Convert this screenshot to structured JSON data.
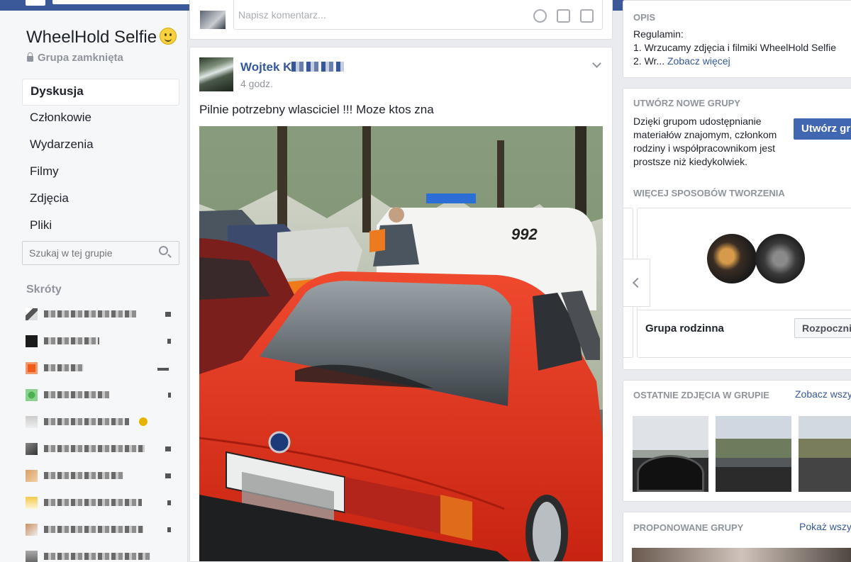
{
  "topbar": {
    "search_placeholder": ""
  },
  "group": {
    "title": "WheelHold Selfie",
    "privacy": "Grupa zamknięta"
  },
  "nav": [
    {
      "label": "Dyskusja",
      "active": true
    },
    {
      "label": "Członkowie"
    },
    {
      "label": "Wydarzenia"
    },
    {
      "label": "Filmy"
    },
    {
      "label": "Zdjęcia"
    },
    {
      "label": "Pliki"
    }
  ],
  "group_search": {
    "placeholder": "Szukaj w tej grupie"
  },
  "shortcuts": {
    "heading": "Skróty",
    "icons": [
      "group-icon",
      "page-icon",
      "app-icon",
      "game-icon",
      "group-icon",
      "group-icon",
      "group-icon",
      "group-icon",
      "group-icon",
      "group-icon"
    ]
  },
  "composer": {
    "placeholder": "Napisz komentarz..."
  },
  "post": {
    "author_visible": "Wojtek K",
    "time": "4 godz.",
    "text": "Pilnie potrzebny wlasciciel !!! Moze ktos zna",
    "photo": {
      "van_number": "992"
    }
  },
  "right": {
    "about": {
      "heading": "OPIS",
      "rules_title": "Regulamin:",
      "rule1": "1. Wrzucamy zdjęcia i filmiki WheelHold Selfie",
      "rule2": "2. Wr...",
      "see_more": "Zobacz więcej"
    },
    "create": {
      "heading": "UTWÓRZ NOWE GRUPY",
      "line1": "Dzięki grupom udostępnianie",
      "line2": "materiałów znajomym, członkom",
      "line3": "rodziny i współpracownikom jest",
      "line4": "prostsze niż kiedykolwiek.",
      "button": "Utwórz grupę"
    },
    "more_ways": {
      "heading": "WIĘCEJ SPOSOBÓW TWORZENIA",
      "card_title": "Grupa rodzinna",
      "card_button": "Rozpocznij"
    },
    "recent_photos": {
      "heading": "OSTATNIE ZDJĘCIA W GRUPIE",
      "link": "Zobacz wszystkie"
    },
    "suggested": {
      "heading": "PROPONOWANE GRUPY",
      "link": "Pokaż wszystkie"
    }
  },
  "colors": {
    "facebook_blue": "#3b5998",
    "link_blue": "#365899",
    "button_blue": "#4267b2",
    "car_red": "#e23a22"
  }
}
